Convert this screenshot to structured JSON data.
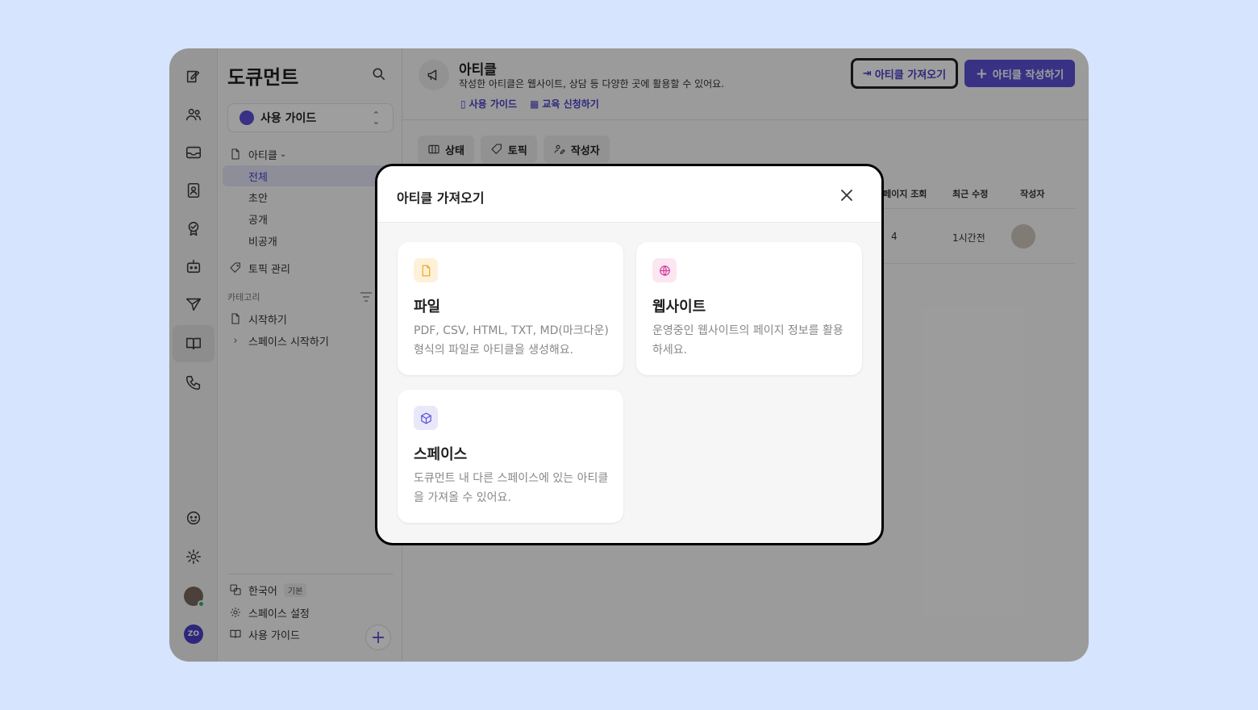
{
  "sidebar": {
    "title": "도큐먼트",
    "space_name": "사용 가이드",
    "articles_label": "아티클",
    "article_filters": [
      "전체",
      "초안",
      "공개",
      "비공개"
    ],
    "topic_manage": "토픽 관리",
    "category_heading": "카테고리",
    "categories": [
      "시작하기",
      "스페이스 시작하기"
    ],
    "language": "한국어",
    "language_badge": "기본",
    "space_settings": "스페이스 설정",
    "user_guide": "사용 가이드"
  },
  "header": {
    "title": "아티클",
    "description": "작성한 아티클은 웹사이트, 상담 등 다양한 곳에 활용할 수 있어요.",
    "link_guide": "사용 가이드",
    "link_training": "교육 신청하기",
    "import_button": "아티클 가져오기",
    "write_button": "아티클 작성하기"
  },
  "filters": [
    "상태",
    "토픽",
    "작성자"
  ],
  "table": {
    "columns": [
      "페이지 조회",
      "최근 수정",
      "작성자"
    ],
    "rows": [
      {
        "views": "4",
        "updated": "1시간전"
      }
    ]
  },
  "modal": {
    "title": "아티클 가져오기",
    "options": [
      {
        "title": "파일",
        "description": "PDF, CSV, HTML, TXT, MD(마크다운) 형식의 파일로 아티클을 생성해요.",
        "icon": "file-icon",
        "color": "#f3a623",
        "bg": "#fdf1d9"
      },
      {
        "title": "웹사이트",
        "description": "운영중인 웹사이트의 페이지 정보를 활용하세요.",
        "icon": "globe-icon",
        "color": "#d13d9a",
        "bg": "#fbe6f2"
      },
      {
        "title": "스페이스",
        "description": "도큐먼트 내 다른 스페이스에 있는 아티클을 가져올 수 있어요.",
        "icon": "cube-icon",
        "color": "#5b50d6",
        "bg": "#e9e7fa"
      }
    ]
  },
  "colors": {
    "accent": "#5b50d6",
    "background": "#d6e4fd",
    "overlay": "rgba(0,0,0,0.38)"
  },
  "user": {
    "workspace_badge": "ZO"
  }
}
